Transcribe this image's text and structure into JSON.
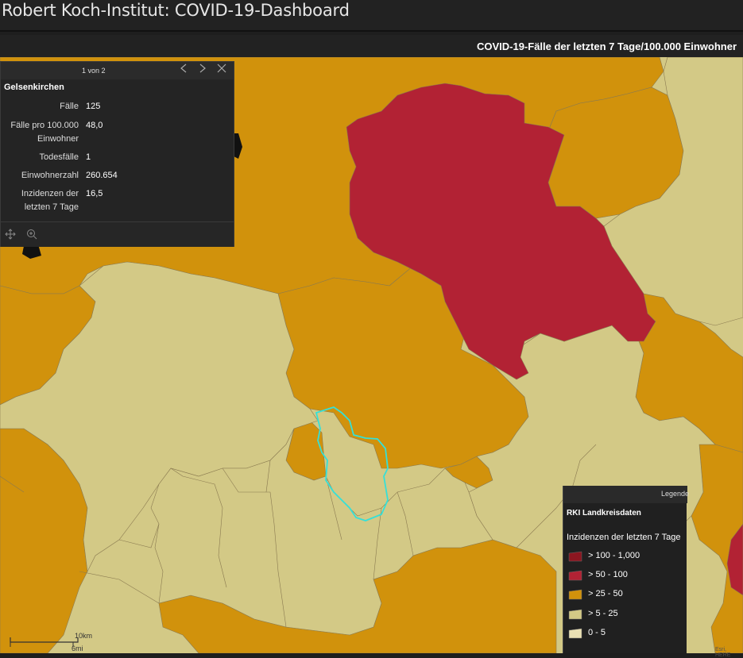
{
  "header": {
    "title": "Robert Koch-Institut: COVID-19-Dashboard"
  },
  "panel": {
    "title": "COVID-19-Fälle der letzten 7 Tage/100.000 Einwohner"
  },
  "colors": {
    "gt100": "#8c1620",
    "gt50": "#b22234",
    "gt25": "#d1920c",
    "gt5": "#d3c986",
    "gt0": "#eae0b4",
    "selection": "#35e0d8",
    "boundary": "#8a7a50"
  },
  "popup": {
    "pager": "1 von 2",
    "prev_icon": "chevron-left-icon",
    "next_icon": "chevron-right-icon",
    "close_icon": "close-icon",
    "feature_title": "Gelsenkirchen",
    "fields": [
      {
        "label": "Fälle",
        "value": "125"
      },
      {
        "label": "Fälle pro 100.000 Einwohner",
        "label_line1": "Fälle pro 100.000",
        "label_line2": "Einwohner",
        "value": "48,0"
      },
      {
        "label": "Todesfälle",
        "value": "1"
      },
      {
        "label": "Einwohnerzahl",
        "value": "260.654"
      },
      {
        "label": "Inzidenzen der letzten 7 Tage",
        "label_line1": "Inzidenzen der",
        "label_line2": "letzten 7 Tage",
        "value": "16,5"
      }
    ],
    "footer_icons": [
      "pan-icon",
      "zoom-to-icon"
    ]
  },
  "legend": {
    "tab_label": "Legende",
    "layer_title": "RKI Landkreisdaten",
    "field_title": "Inzidenzen der letzten 7 Tage",
    "items": [
      {
        "label": "> 100 - 1,000",
        "color": "#8c1620"
      },
      {
        "label": "> 50 - 100",
        "color": "#b22234"
      },
      {
        "label": "> 25 - 50",
        "color": "#d1920c"
      },
      {
        "label": "> 5 - 25",
        "color": "#d3c986"
      },
      {
        "label": "0 - 5",
        "color": "#eae0b4"
      }
    ]
  },
  "scalebar": {
    "km_label": "10km",
    "mi_label": "6mi"
  },
  "attribution": "Esri, HERE"
}
